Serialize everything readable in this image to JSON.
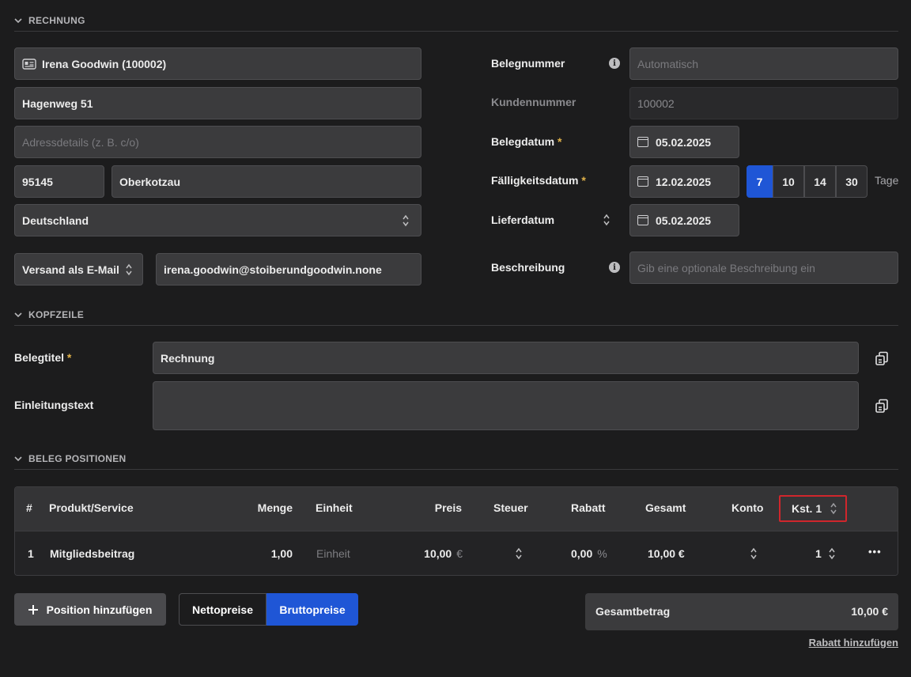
{
  "sections": {
    "rechnung": "RECHNUNG",
    "kopfzeile": "KOPFZEILE",
    "positionen": "BELEG POSITIONEN"
  },
  "customer": {
    "name": "Irena Goodwin (100002)",
    "street": "Hagenweg 51",
    "address_details_placeholder": "Adressdetails (z. B. c/o)",
    "zip": "95145",
    "city": "Oberkotzau",
    "country": "Deutschland",
    "delivery_method": "Versand als E-Mail",
    "email": "irena.goodwin@stoiberundgoodwin.none"
  },
  "document": {
    "belegnummer_label": "Belegnummer",
    "belegnummer_placeholder": "Automatisch",
    "kundennummer_label": "Kundennummer",
    "kundennummer_value": "100002",
    "belegdatum_label": "Belegdatum",
    "belegdatum_value": "05.02.2025",
    "faelligkeit_label": "Fälligkeitsdatum",
    "faelligkeit_value": "12.02.2025",
    "term_options": [
      "7",
      "10",
      "14",
      "30"
    ],
    "term_selected": "7",
    "term_unit": "Tage",
    "lieferdatum_label": "Lieferdatum",
    "lieferdatum_value": "05.02.2025",
    "beschreibung_label": "Beschreibung",
    "beschreibung_placeholder": "Gib eine optionale Beschreibung ein",
    "required_mark": "*"
  },
  "header": {
    "belegtitel_label": "Belegtitel",
    "belegtitel_value": "Rechnung",
    "einleitung_label": "Einleitungstext",
    "einleitung_value": ""
  },
  "table": {
    "columns": {
      "num": "#",
      "product": "Produkt/Service",
      "qty": "Menge",
      "unit": "Einheit",
      "price": "Preis",
      "tax": "Steuer",
      "discount": "Rabatt",
      "total": "Gesamt",
      "account": "Konto",
      "cost_center": "Kst. 1"
    },
    "rows": [
      {
        "num": "1",
        "product": "Mitgliedsbeitrag",
        "qty": "1,00",
        "unit_placeholder": "Einheit",
        "price": "10,00",
        "currency": "€",
        "discount": "0,00",
        "percent": "%",
        "total": "10,00 €",
        "cost_center": "1"
      }
    ],
    "row_menu": "•••"
  },
  "footer": {
    "add_position": "Position hinzufügen",
    "net_prices": "Nettopreise",
    "gross_prices": "Bruttopreise",
    "price_mode_selected": "Bruttopreise",
    "total_label": "Gesamtbetrag",
    "total_value": "10,00 €",
    "add_discount": "Rabatt hinzufügen"
  },
  "colors": {
    "accent": "#1f56d6",
    "highlight_box": "#d0262c",
    "required": "#e0b24a",
    "background": "#1c1c1d"
  }
}
